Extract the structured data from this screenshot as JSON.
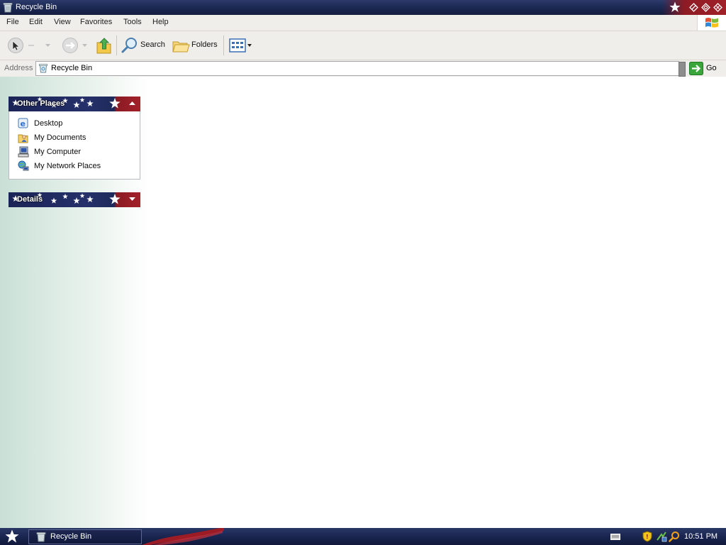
{
  "window": {
    "title": "Recycle Bin"
  },
  "menu": {
    "items": [
      "File",
      "Edit",
      "View",
      "Favorites",
      "Tools",
      "Help"
    ]
  },
  "toolbar": {
    "search_label": "Search",
    "folders_label": "Folders"
  },
  "address": {
    "label": "Address",
    "value": "Recycle Bin",
    "go_label": "Go"
  },
  "task_pane": {
    "other_places": {
      "title": "Other Places",
      "items": [
        {
          "label": "Desktop",
          "icon": "desktop-icon"
        },
        {
          "label": "My Documents",
          "icon": "my-documents-icon"
        },
        {
          "label": "My Computer",
          "icon": "my-computer-icon"
        },
        {
          "label": "My Network Places",
          "icon": "network-places-icon"
        }
      ]
    },
    "details": {
      "title": "Details"
    }
  },
  "taskbar": {
    "task_label": "Recycle Bin",
    "clock": "10:51 PM"
  },
  "colors": {
    "titlebar": "#1d2a55",
    "flag_red": "#a02028",
    "panel_navy": "#1b2456",
    "chrome": "#efeeeb"
  }
}
